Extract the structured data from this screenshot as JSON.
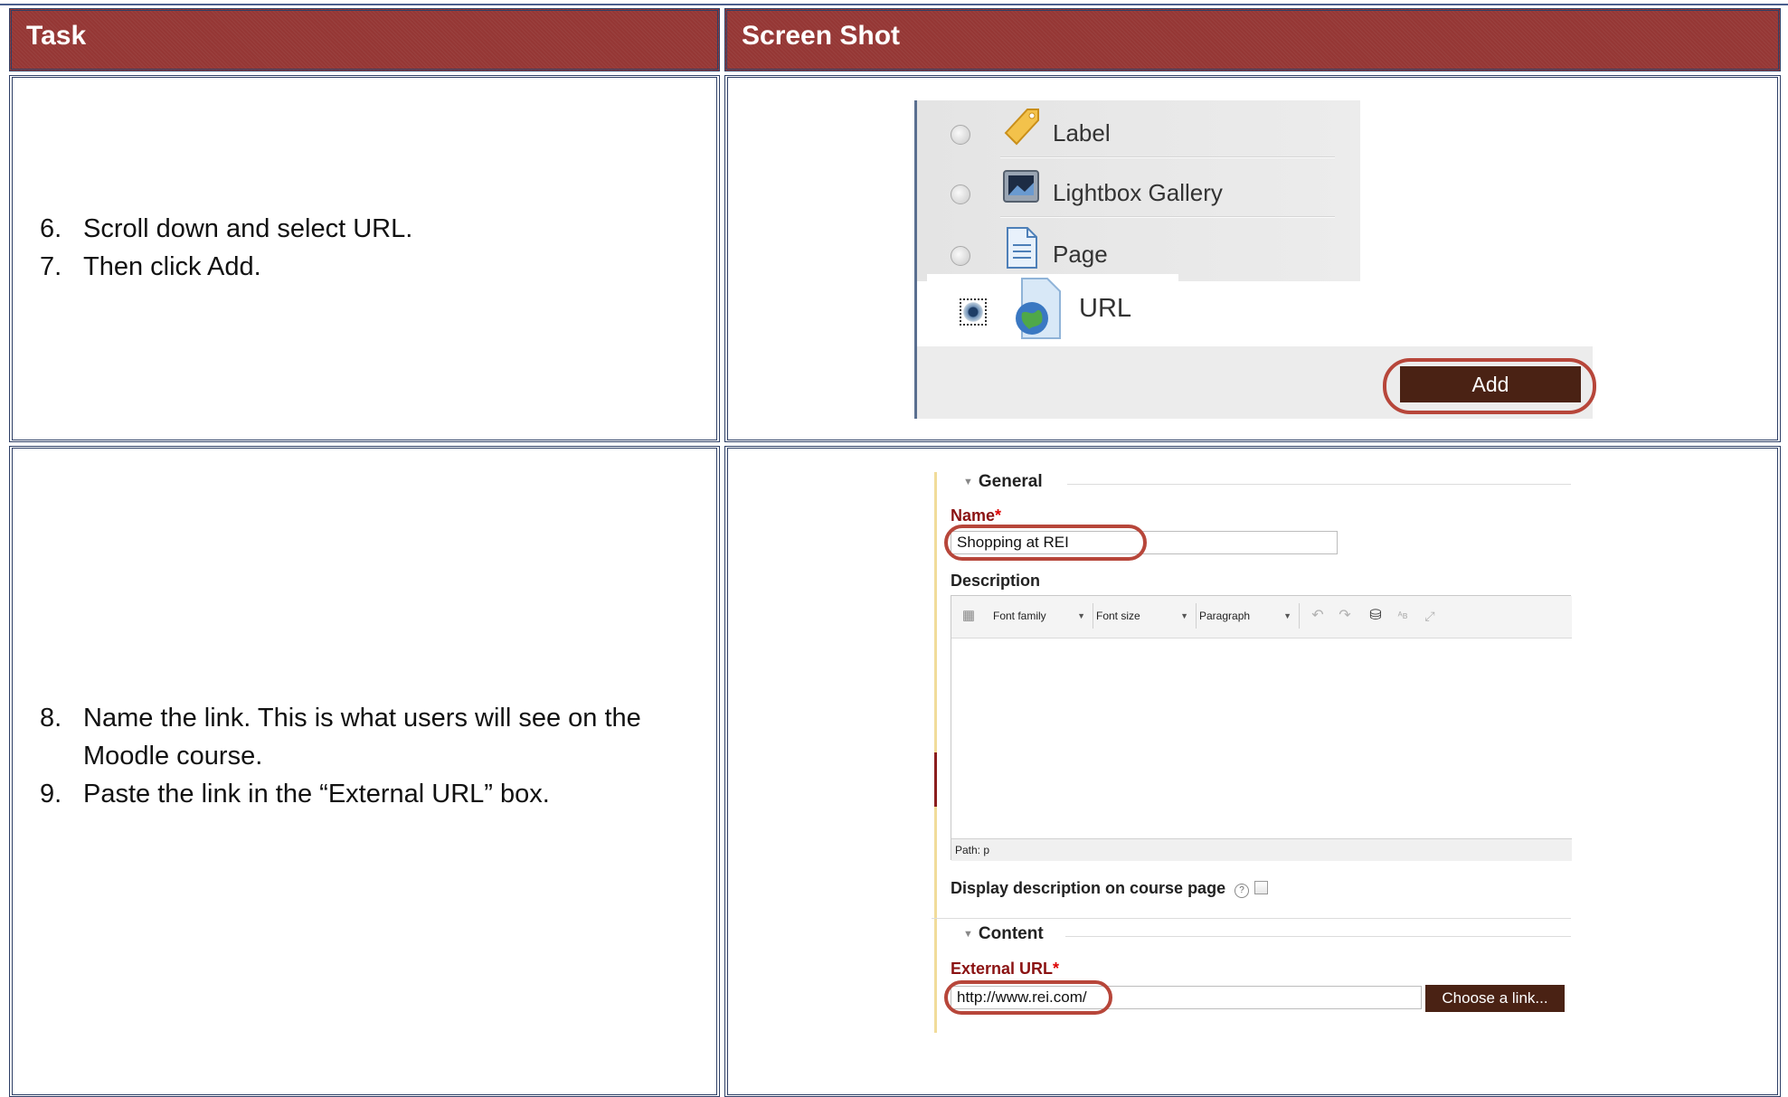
{
  "header": {
    "task_label": "Task",
    "screenshot_label": "Screen Shot"
  },
  "steps_block_1": [
    {
      "num": "6.",
      "text": "Scroll down and select URL."
    },
    {
      "num": "7.",
      "text": "Then click Add."
    }
  ],
  "steps_block_2": [
    {
      "num": "8.",
      "text": "Name the link. This is what users will see on the",
      "cont": "Moodle course."
    },
    {
      "num": "9.",
      "text": "Paste the link in the “External URL” box."
    }
  ],
  "screenshot_1": {
    "options": [
      {
        "label": "Label",
        "icon": "tag-icon",
        "selected": false
      },
      {
        "label": "Lightbox Gallery",
        "icon": "gallery-icon",
        "selected": false
      },
      {
        "label": "Page",
        "icon": "page-icon",
        "selected": false
      },
      {
        "label": "URL",
        "icon": "globe-icon",
        "selected": true
      }
    ],
    "add_button": "Add"
  },
  "screenshot_2": {
    "general_legend": "General",
    "name_label": "Name",
    "required_mark": "*",
    "name_value": "Shopping at REI",
    "description_label": "Description",
    "toolbar": {
      "font_family": "Font family",
      "font_size": "Font size",
      "paragraph": "Paragraph"
    },
    "path_text": "Path: p",
    "display_description_label": "Display description on course page",
    "content_legend": "Content",
    "external_url_label": "External URL",
    "external_url_value": "http://www.rei.com/",
    "choose_link_button": "Choose a link..."
  },
  "colors": {
    "header_bg": "#953735",
    "button_bg": "#4a2214",
    "highlight_ring": "#b7463a"
  }
}
